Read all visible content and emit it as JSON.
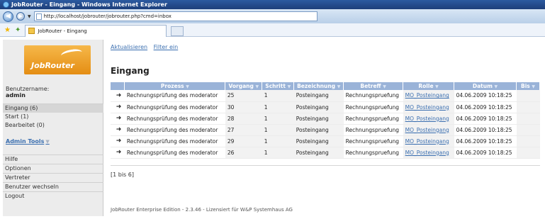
{
  "window": {
    "title": "JobRouter - Eingang - Windows Internet Explorer"
  },
  "browser": {
    "url": "http://localhost/jobrouter/jobrouter.php?cmd=inbox",
    "tab_label": "JobRouter - Eingang"
  },
  "sidebar": {
    "logo_text": "JobRouter",
    "username_label": "Benutzername:",
    "username": "admin",
    "nav": [
      {
        "label": "Eingang (6)"
      },
      {
        "label": "Start (1)"
      },
      {
        "label": "Bearbeitet (0)"
      }
    ],
    "admin_tools": "Admin Tools",
    "bottom": [
      {
        "label": "Hilfe"
      },
      {
        "label": "Optionen"
      },
      {
        "label": "Vertreter"
      },
      {
        "label": "Benutzer wechseln"
      },
      {
        "label": "Logout"
      }
    ]
  },
  "main": {
    "links": {
      "refresh": "Aktualisieren",
      "filter": "Filter ein"
    },
    "title": "Eingang",
    "columns": [
      "Prozess",
      "Vorgang",
      "Schritt",
      "Bezeichnung",
      "Betreff",
      "Rolle",
      "Datum",
      "Bis"
    ],
    "rows": [
      {
        "prozess": "Rechnungsprüfung des moderator",
        "vorgang": "25",
        "schritt": "1",
        "bezeichnung": "Posteingang",
        "betreff": "Rechnungspruefung",
        "rolle": "MO_Posteingang",
        "datum": "04.06.2009 10:18:25",
        "bis": ""
      },
      {
        "prozess": "Rechnungsprüfung des moderator",
        "vorgang": "30",
        "schritt": "1",
        "bezeichnung": "Posteingang",
        "betreff": "Rechnungspruefung",
        "rolle": "MO_Posteingang",
        "datum": "04.06.2009 10:18:25",
        "bis": ""
      },
      {
        "prozess": "Rechnungsprüfung des moderator",
        "vorgang": "28",
        "schritt": "1",
        "bezeichnung": "Posteingang",
        "betreff": "Rechnungspruefung",
        "rolle": "MO_Posteingang",
        "datum": "04.06.2009 10:18:25",
        "bis": ""
      },
      {
        "prozess": "Rechnungsprüfung des moderator",
        "vorgang": "27",
        "schritt": "1",
        "bezeichnung": "Posteingang",
        "betreff": "Rechnungspruefung",
        "rolle": "MO_Posteingang",
        "datum": "04.06.2009 10:18:25",
        "bis": ""
      },
      {
        "prozess": "Rechnungsprüfung des moderator",
        "vorgang": "29",
        "schritt": "1",
        "bezeichnung": "Posteingang",
        "betreff": "Rechnungspruefung",
        "rolle": "MO_Posteingang",
        "datum": "04.06.2009 10:18:25",
        "bis": ""
      },
      {
        "prozess": "Rechnungsprüfung des moderator",
        "vorgang": "26",
        "schritt": "1",
        "bezeichnung": "Posteingang",
        "betreff": "Rechnungspruefung",
        "rolle": "MO_Posteingang",
        "datum": "04.06.2009 10:18:25",
        "bis": ""
      }
    ],
    "paging": "[1 bis 6]",
    "footer": "JobRouter Enterprise Edition - 2.3.46 - Lizensiert für W&P Systemhaus AG"
  },
  "icons": {
    "row_arrow": "arrow-right-icon",
    "back": "back-arrow-icon",
    "forward": "forward-arrow-icon",
    "favorites": "star-icon"
  },
  "colors": {
    "accent": "#3b6fb0",
    "header_bg": "#9ab3d8",
    "logo": "#e48d13"
  }
}
